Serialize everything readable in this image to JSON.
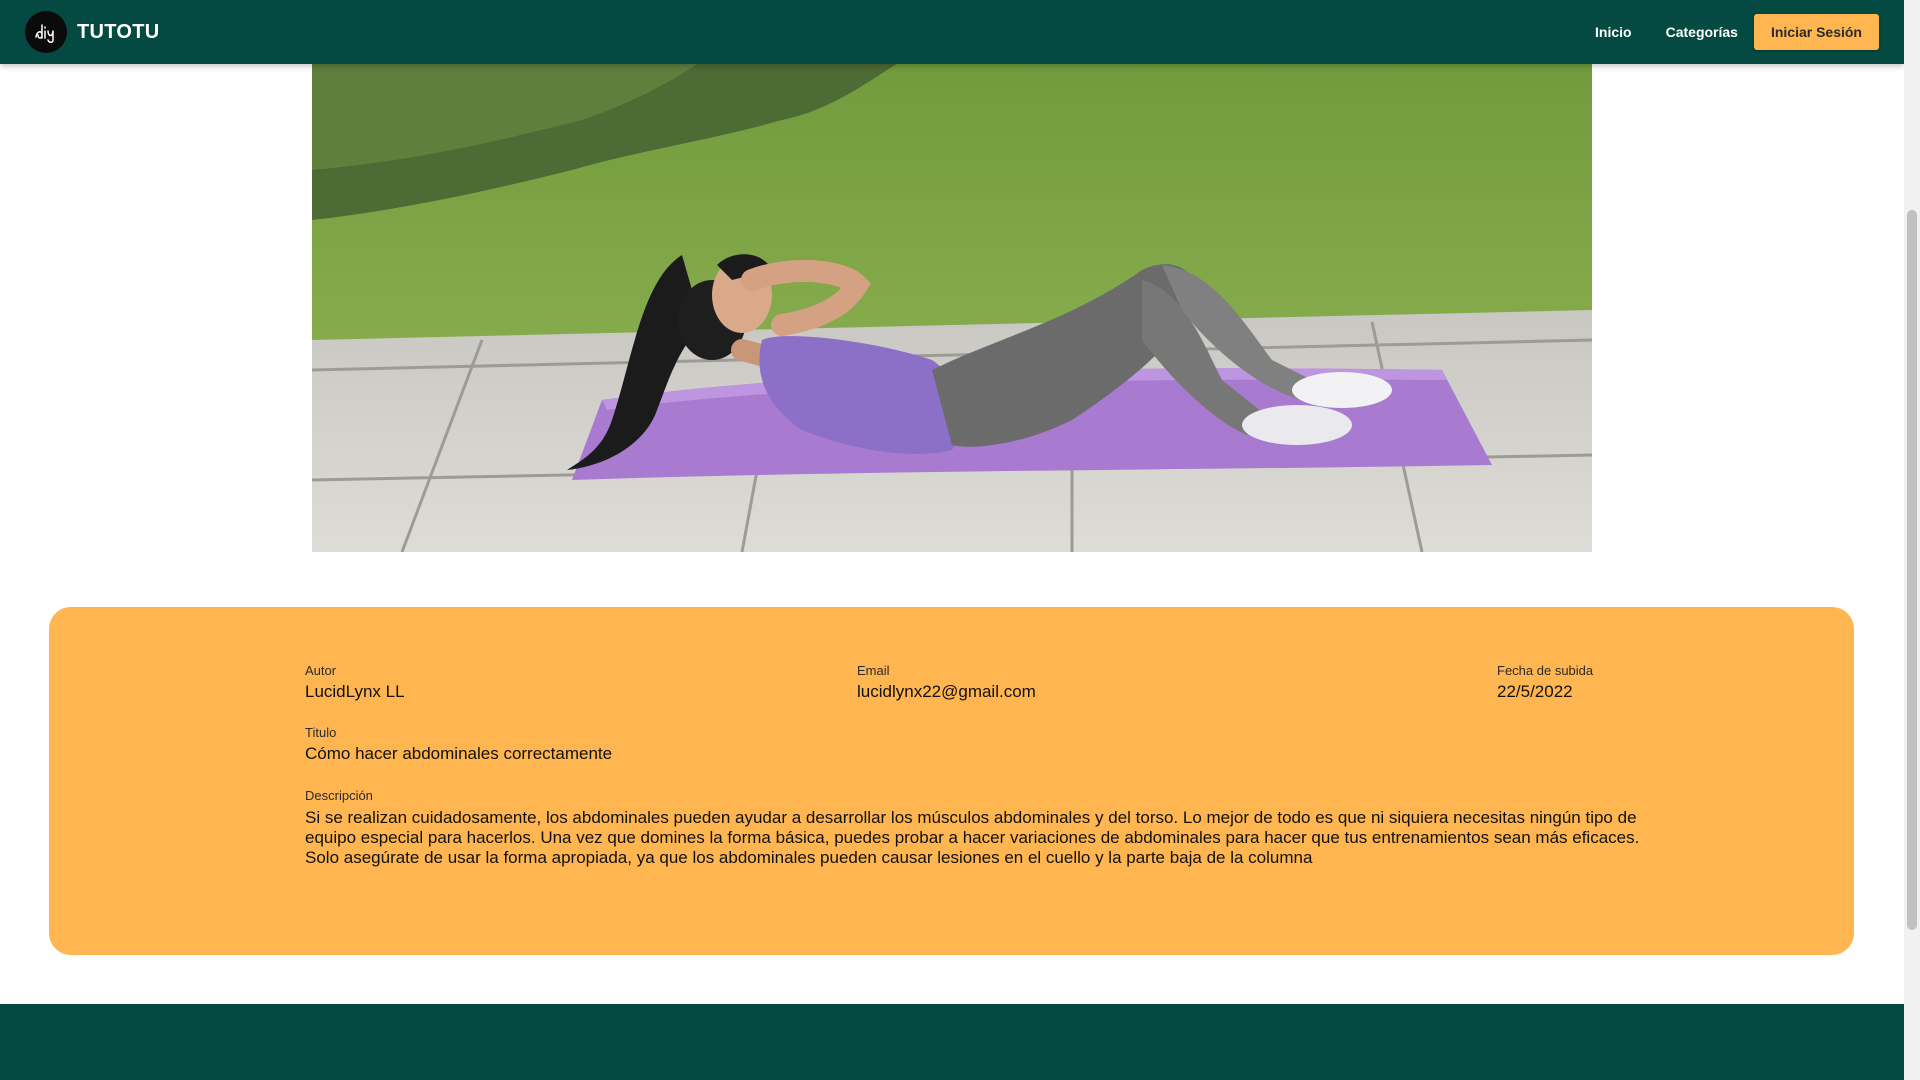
{
  "app": {
    "name": "TUTOTU",
    "logo_text": "diy"
  },
  "nav": {
    "home_label": "Inicio",
    "categories_label": "Categorías",
    "login_label": "Iniciar Sesión"
  },
  "post": {
    "author_label": "Autor",
    "author": "LucidLynx LL",
    "email_label": "Email",
    "email": "lucidlynx22@gmail.com",
    "date_label": "Fecha de subida",
    "date": "22/5/2022",
    "title_label": "Titulo",
    "title": "Cómo hacer abdominales correctamente",
    "description_label": "Descripción",
    "description": "Si se realizan cuidadosamente, los abdominales pueden ayudar a desarrollar los músculos abdominales y del torso. Lo mejor de todo es que ni siquiera necesitas ningún tipo de equipo especial para hacerlos. Una vez que domines la forma básica, puedes probar a hacer variaciones de abdominales para hacer que tus entrenamientos sean más eficaces. Solo asegúrate de usar la forma apropiada, ya que los abdominales pueden causar lesiones en el cuello y la parte baja de la columna"
  },
  "colors": {
    "primary": "#044a42",
    "accent": "#ffb550"
  }
}
